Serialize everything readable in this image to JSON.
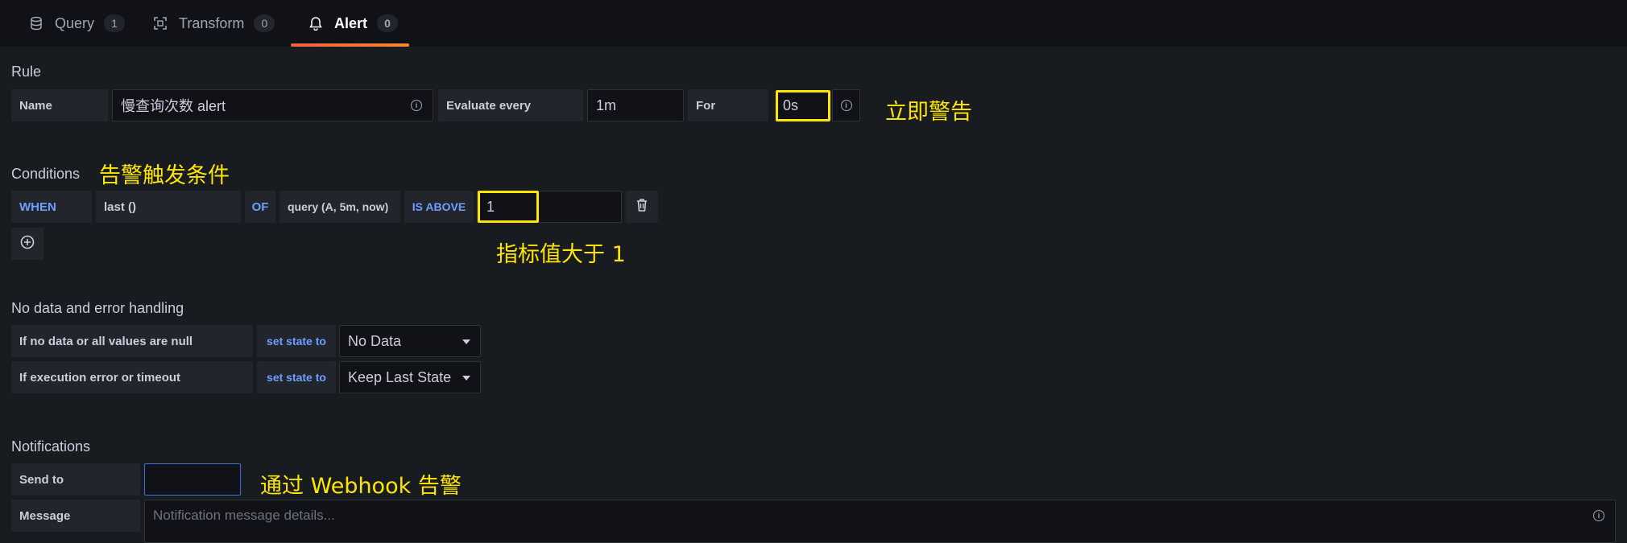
{
  "tabs": [
    {
      "label": "Query",
      "count": "1",
      "icon": "database-icon"
    },
    {
      "label": "Transform",
      "count": "0",
      "icon": "transform-icon"
    },
    {
      "label": "Alert",
      "count": "0",
      "icon": "bell-icon"
    }
  ],
  "rule": {
    "title": "Rule",
    "name_label": "Name",
    "name_value": "慢查询次数 alert",
    "evaluate_label": "Evaluate every",
    "evaluate_value": "1m",
    "for_label": "For",
    "for_value": "0s",
    "annotation": "立即警告"
  },
  "conditions": {
    "title": "Conditions",
    "annotation_title": "告警触发条件",
    "when": "WHEN",
    "reducer": "last ()",
    "of": "OF",
    "query": "query (A, 5m, now)",
    "evaluator": "IS ABOVE",
    "threshold": "1",
    "annotation_threshold": "指标值大于 1"
  },
  "nodata": {
    "title": "No data and error handling",
    "row1_label": "If no data or all values are null",
    "row1_set": "set state to",
    "row1_value": "No Data",
    "row2_label": "If execution error or timeout",
    "row2_set": "set state to",
    "row2_value": "Keep Last State"
  },
  "notifications": {
    "title": "Notifications",
    "send_label": "Send to",
    "send_value": "",
    "annotation": "通过 Webhook 告警",
    "message_label": "Message",
    "message_placeholder": "Notification message details..."
  },
  "colors": {
    "background": "#111217",
    "panel": "#181b1f",
    "accent_tab": "#ff8833",
    "keyword": "#6e9fff",
    "annotation": "#ffe600"
  }
}
